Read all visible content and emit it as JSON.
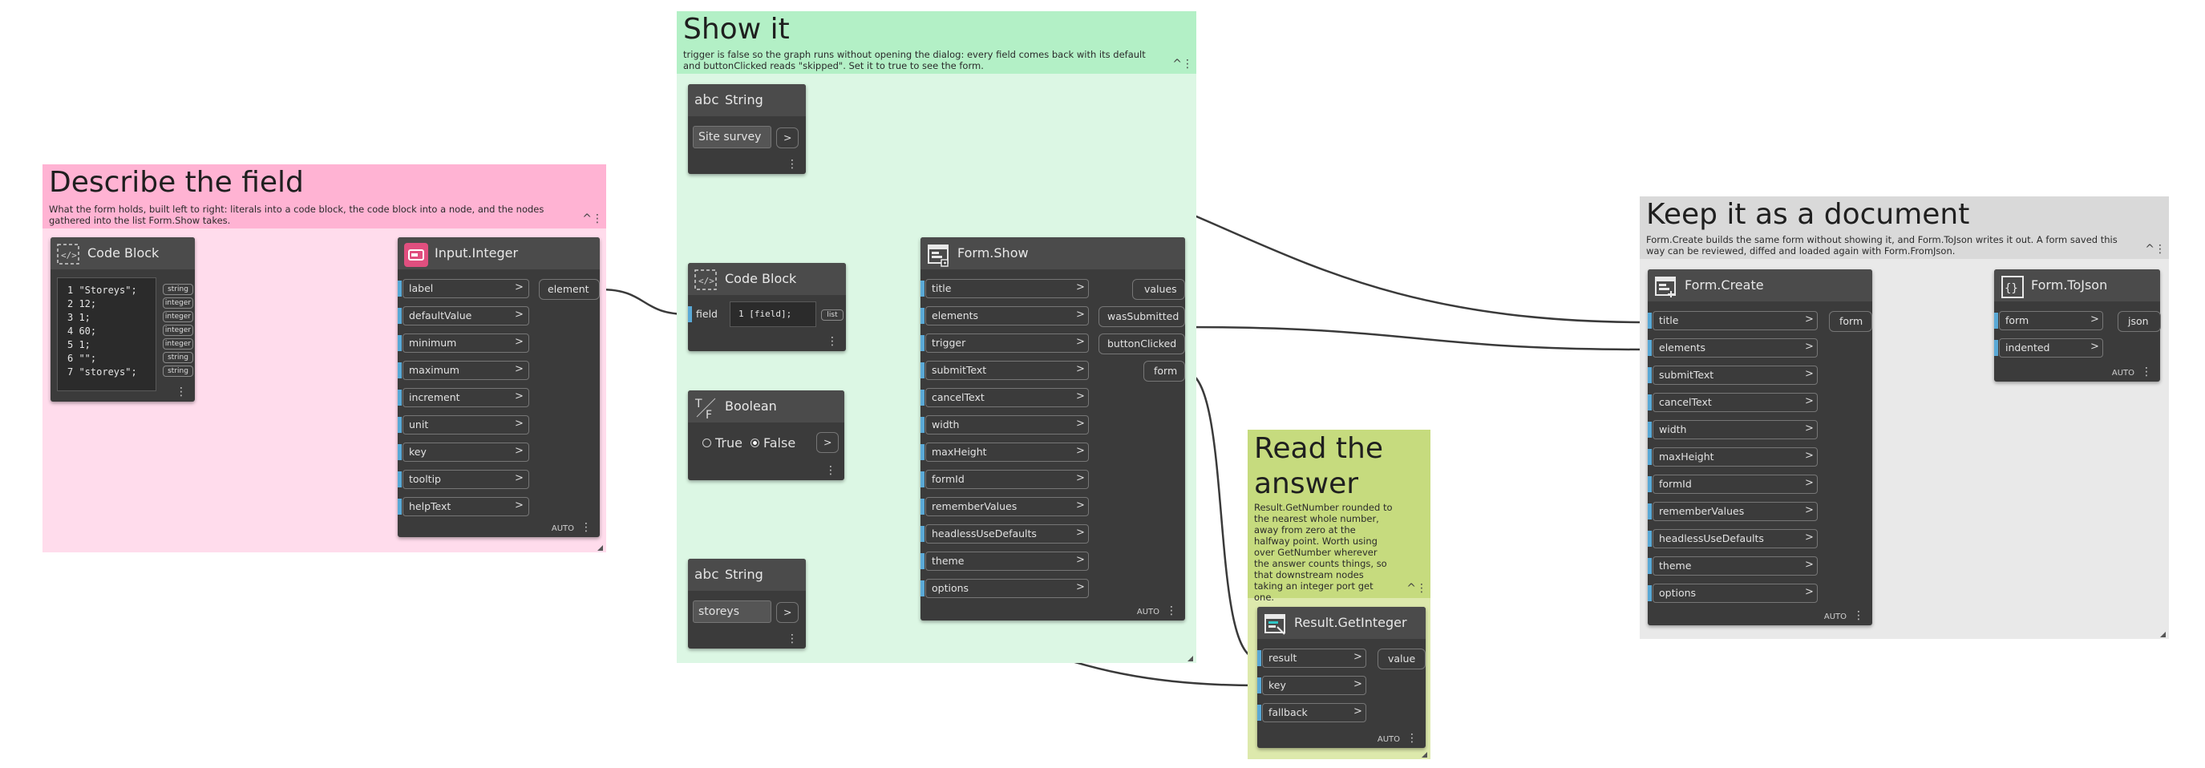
{
  "groups": {
    "describe": {
      "title": "Describe the field",
      "desc": "What the form holds, built left to right: literals into a code block, the code block into a node, and the nodes gathered into the list Form.Show takes.",
      "color": "#ffb3d3",
      "body": "#ffdcec"
    },
    "show": {
      "title": "Show it",
      "desc": "trigger is false so the graph runs without opening the dialog: every field comes back with its default and buttonClicked reads \"skipped\". Set it to true to see the form.",
      "color": "#b3f0c6",
      "body": "#dcf7e4"
    },
    "read": {
      "title": "Read the answer",
      "desc": "Result.GetNumber rounded to the nearest whole number, away from zero at the halfway point. Worth using over GetNumber wherever the answer counts things, so that downstream nodes taking an integer port get one.",
      "color": "#c6db7e",
      "body": "#dde9ac"
    },
    "keep": {
      "title": "Keep it as a document",
      "desc": "Form.Create builds the same form without showing it, and Form.ToJson writes it out. A form saved this way can be reviewed, diffed and loaded again with Form.FromJson.",
      "color": "#d9d9d9",
      "body": "#e9e9e9"
    }
  },
  "group_controls": {
    "collapse": "^",
    "menu": "⋮"
  },
  "nodes": {
    "code_block_1": {
      "title": "Code Block",
      "lines": [
        "1 \"Storeys\";",
        "2 12;",
        "3 1;",
        "4 60;",
        "5 1;",
        "6 \"\";",
        "7 \"storeys\";"
      ],
      "out_tags": [
        "string",
        "integer",
        "integer",
        "integer",
        "integer",
        "string",
        "string"
      ]
    },
    "input_integer": {
      "title": "Input.Integer",
      "inputs": [
        "label",
        "defaultValue",
        "minimum",
        "maximum",
        "increment",
        "unit",
        "key",
        "tooltip",
        "helpText"
      ],
      "output": "element",
      "lacing": "AUTO"
    },
    "string_1": {
      "title": "String",
      "value": "Site survey",
      "out": ">"
    },
    "code_block_2": {
      "title": "Code Block",
      "input": "field",
      "code": "1 [field];",
      "out": "list"
    },
    "boolean": {
      "title": "Boolean",
      "true_label": "True",
      "false_label": "False",
      "selected": "False",
      "out": ">"
    },
    "string_2": {
      "title": "String",
      "value": "storeys",
      "out": ">"
    },
    "form_show": {
      "title": "Form.Show",
      "inputs": [
        "title",
        "elements",
        "trigger",
        "submitText",
        "cancelText",
        "width",
        "maxHeight",
        "formId",
        "rememberValues",
        "headlessUseDefaults",
        "theme",
        "options"
      ],
      "outputs": [
        "values",
        "wasSubmitted",
        "buttonClicked",
        "form"
      ],
      "lacing": "AUTO"
    },
    "result_get_integer": {
      "title": "Result.GetInteger",
      "inputs": [
        "result",
        "key",
        "fallback"
      ],
      "output": "value",
      "lacing": "AUTO"
    },
    "form_create": {
      "title": "Form.Create",
      "inputs": [
        "title",
        "elements",
        "submitText",
        "cancelText",
        "width",
        "maxHeight",
        "formId",
        "rememberValues",
        "headlessUseDefaults",
        "theme",
        "options"
      ],
      "output": "form",
      "lacing": "AUTO"
    },
    "form_to_json": {
      "title": "Form.ToJson",
      "inputs": [
        "form",
        "indented"
      ],
      "output": "json",
      "lacing": "AUTO"
    }
  },
  "port_arrow": ">",
  "icons": {
    "string": "abc-icon",
    "code_block": "code-block-icon",
    "boolean": "boolean-icon",
    "input_integer": "input-integer-icon",
    "form_show": "form-show-icon",
    "result": "result-icon",
    "form_create": "form-create-icon",
    "to_json": "json-icon"
  }
}
